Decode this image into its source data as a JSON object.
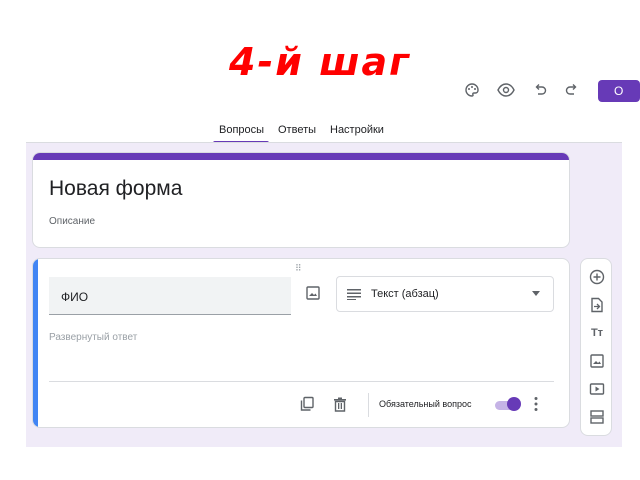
{
  "step_title": "4-й шаг",
  "header": {
    "icons": [
      "palette-icon",
      "preview-eye-icon",
      "undo-icon",
      "redo-icon"
    ],
    "send_label": "О"
  },
  "tabs": [
    {
      "label": "Вопросы",
      "active": true
    },
    {
      "label": "Ответы",
      "active": false
    },
    {
      "label": "Настройки",
      "active": false
    }
  ],
  "form": {
    "title": "Новая форма",
    "description": "Описание"
  },
  "question": {
    "title_value": "ФИО",
    "type_label": "Текст (абзац)",
    "answer_hint": "Развернутый ответ",
    "required_label": "Обязательный вопрос",
    "required": true
  },
  "side_toolbar": [
    "add-question-icon",
    "import-questions-icon",
    "add-title-icon",
    "add-image-icon",
    "add-video-icon",
    "add-section-icon"
  ],
  "colors": {
    "accent": "#673ab7",
    "active_card_bar": "#4285f4",
    "canvas_bg": "#f0ebf8",
    "step_title": "#ff0000"
  }
}
